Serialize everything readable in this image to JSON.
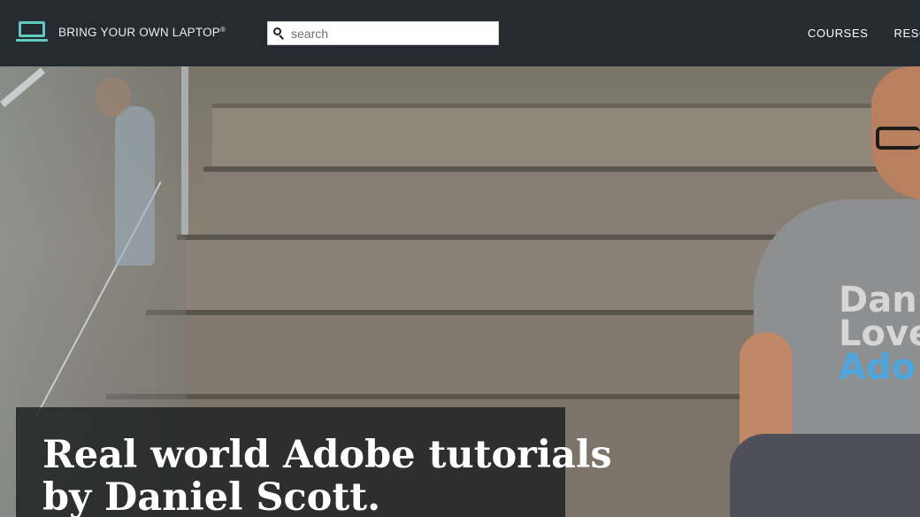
{
  "header": {
    "logo_text": "BRING YOUR OWN LAPTOP",
    "logo_mark": "®",
    "search": {
      "placeholder": "search",
      "value": ""
    },
    "nav": [
      {
        "label": "COURSES"
      },
      {
        "label": "RESOU"
      }
    ]
  },
  "hero": {
    "headline_line1": "Real world Adobe tutorials",
    "headline_line2": "by Daniel Scott.",
    "shirt_line1": "Dan",
    "shirt_line2": "Love",
    "shirt_line3": "Ado"
  },
  "colors": {
    "header_bg": "#262a31",
    "logo_accent": "#5fc9c2",
    "caption_bg": "#1c1e20",
    "text_light": "#ffffff",
    "shirt_accent": "#4fa6dd"
  },
  "icons": [
    "laptop-icon",
    "search-icon"
  ]
}
